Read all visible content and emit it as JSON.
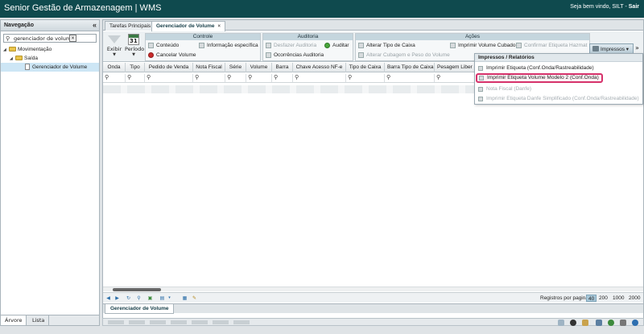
{
  "header": {
    "title": "Senior Gestão de Armazenagem | WMS",
    "welcome_prefix": "Seja bem vindo, SILT -",
    "logout": "Sair"
  },
  "sidebar": {
    "title": "Navegação",
    "collapse": "«",
    "search_value": "gerenciador de volume",
    "tree": {
      "root": "Movimentação",
      "child": "Saída",
      "leaf": "Gerenciador de Volume"
    },
    "tabs": [
      "Árvore",
      "Lista"
    ]
  },
  "tabs": {
    "tab1": "Tarefas Principais",
    "tab2": "Gerenciador de Volume",
    "close": "×"
  },
  "toolbar": {
    "exibir": "Exibir",
    "periodo": "Período",
    "calendar_day": "31",
    "controle": {
      "title": "Controle",
      "conteudo": "Conteúdo",
      "info": "Informação específica",
      "cancelar": "Cancelar Volume"
    },
    "auditoria": {
      "title": "Auditoria",
      "desfazer": "Desfazer Auditoria",
      "auditar": "Auditar",
      "ocorrencias": "Ocorrências Auditoria"
    },
    "acoes": {
      "title": "Ações",
      "alterar_tipo": "Alterar Tipo de Caixa",
      "imprimir_cubado": "Imprimir Volume Cubado",
      "confirmar_hazmat": "Confirmar Etiqueta Hazmat",
      "alterar_cubagem": "Alterar Cubagem e Peso do Volume"
    },
    "impressos": "Impressos",
    "more": "»"
  },
  "grid": {
    "columns": [
      "Onda",
      "Tipo",
      "Pedido de Venda",
      "Nota Fiscal",
      "Série",
      "Volume",
      "Barra",
      "Chave Acesso NF-e",
      "Tipo de Caixa",
      "Barra Tipo de Caixa",
      "Pesagem Liber"
    ]
  },
  "dropdown": {
    "title": "Impressos / Relatórios",
    "items": [
      "Imprimir Etiqueta (Conf.Onda/Rastreabilidade)",
      "Imprimir Etiqueta Volume Modelo 2 (Conf.Onda)",
      "Nota Fiscal (Danfe)",
      "Imprimir Etiqueta Danfe Simplificado (Conf.Onda/Rastreabilidade)"
    ]
  },
  "pager": {
    "label": "Registros por pagina:",
    "sizes": [
      "40",
      "200",
      "1000",
      "2000"
    ],
    "active": "40"
  },
  "bottom_tab": "Gerenciador de Volume",
  "colors": {
    "header_bg": "#0f4a4e",
    "highlight": "#d6326b",
    "group_title": "#c5d6de"
  }
}
